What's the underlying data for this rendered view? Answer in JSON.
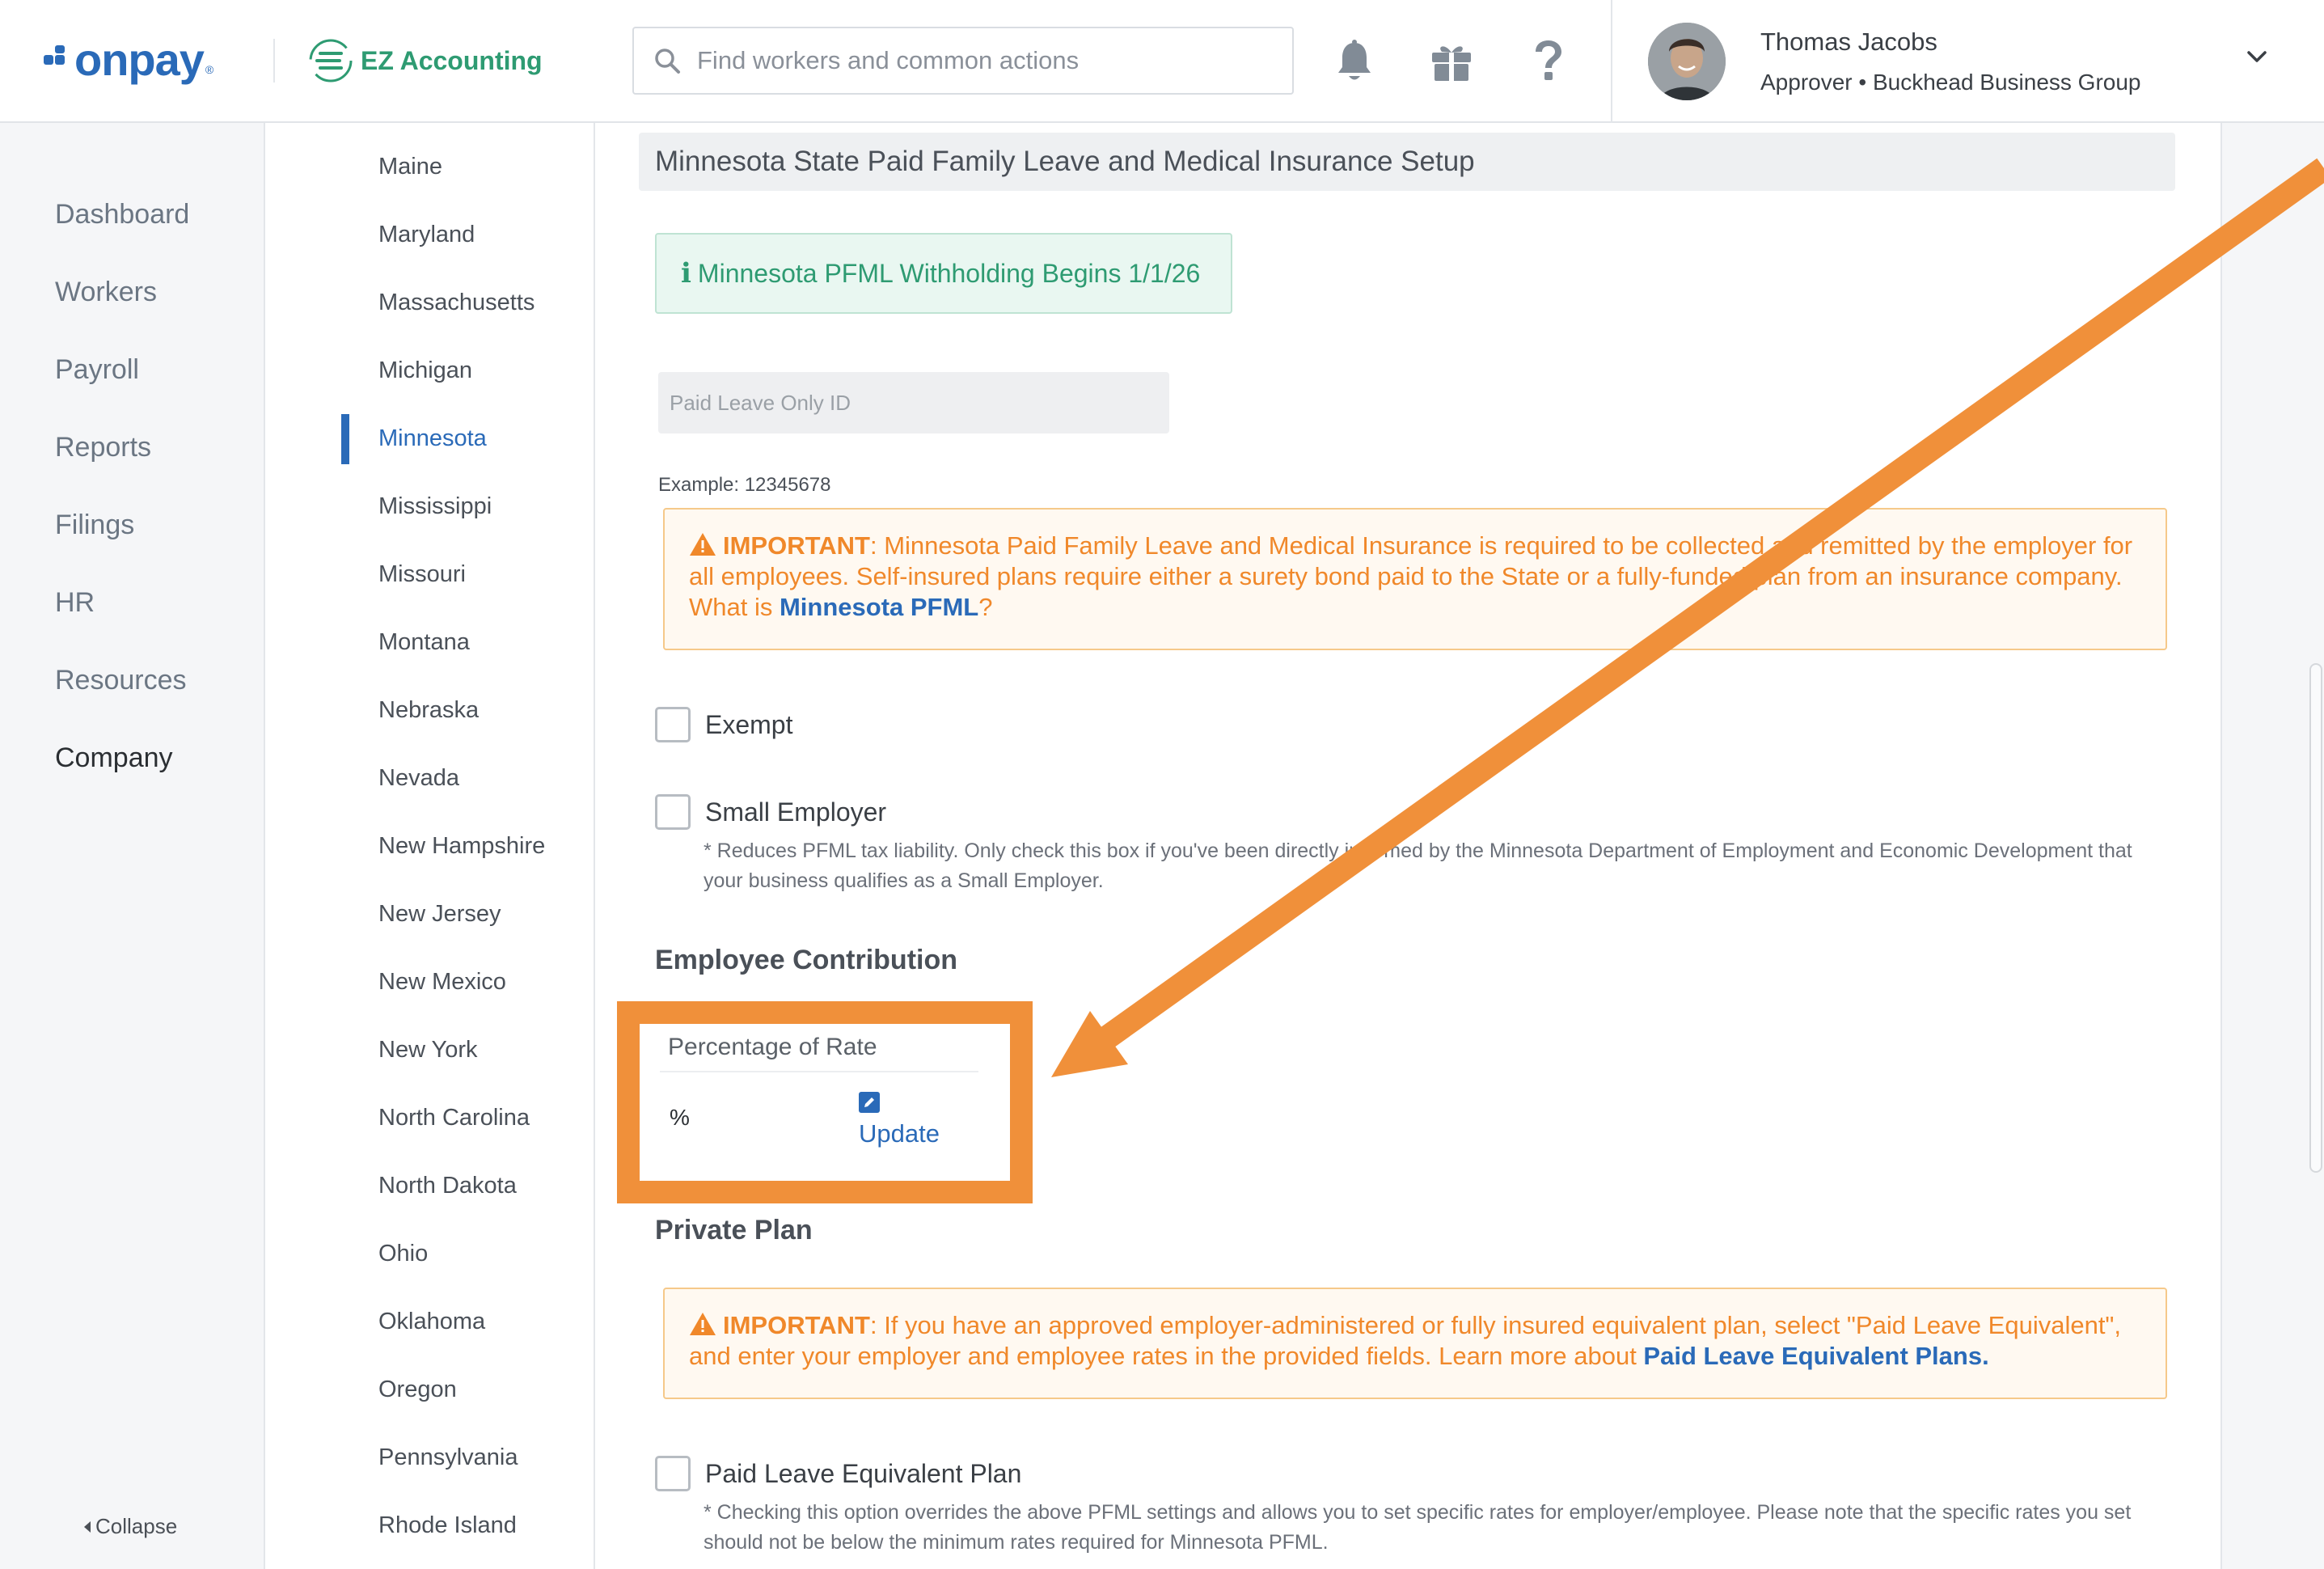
{
  "brand": {
    "onpay": "onpay",
    "partner": "EZ Accounting"
  },
  "search": {
    "placeholder": "Find workers and common actions"
  },
  "user": {
    "name": "Thomas Jacobs",
    "role": "Approver • Buckhead Business Group"
  },
  "nav": {
    "items": [
      {
        "label": "Dashboard",
        "active": false
      },
      {
        "label": "Workers",
        "active": false
      },
      {
        "label": "Payroll",
        "active": false
      },
      {
        "label": "Reports",
        "active": false
      },
      {
        "label": "Filings",
        "active": false
      },
      {
        "label": "HR",
        "active": false
      },
      {
        "label": "Resources",
        "active": false
      },
      {
        "label": "Company",
        "active": true
      }
    ],
    "collapse": "Collapse"
  },
  "states": {
    "items": [
      "Maine",
      "Maryland",
      "Massachusetts",
      "Michigan",
      "Minnesota",
      "Mississippi",
      "Missouri",
      "Montana",
      "Nebraska",
      "Nevada",
      "New Hampshire",
      "New Jersey",
      "New Mexico",
      "New York",
      "North Carolina",
      "North Dakota",
      "Ohio",
      "Oklahoma",
      "Oregon",
      "Pennsylvania",
      "Rhode Island"
    ],
    "selected": "Minnesota"
  },
  "main": {
    "section_title": "Minnesota State Paid Family Leave and Medical Insurance Setup",
    "info_banner": "Minnesota PFML Withholding Begins 1/1/26",
    "id_field": {
      "placeholder": "Paid Leave Only ID",
      "value": ""
    },
    "example": "Example: 12345678",
    "important_label": "IMPORTANT",
    "warning1": {
      "text": ": Minnesota Paid Family Leave and Medical Insurance is required to be collected and remitted by the employer for all employees. Self-insured plans require either a surety bond paid to the State or a fully-funded plan from an insurance company. What is ",
      "link": "Minnesota PFML",
      "suffix": "?"
    },
    "exempt": {
      "label": "Exempt",
      "checked": false
    },
    "small_employer": {
      "label": "Small Employer",
      "checked": false,
      "note": "* Reduces PFML tax liability. Only check this box if you've been directly informed by the Minnesota Department of Employment and Economic Development that your business qualifies as a Small Employer."
    },
    "employee_contribution": {
      "heading": "Employee Contribution",
      "column": "Percentage of Rate",
      "value": "%",
      "update": "Update"
    },
    "private_plan": {
      "heading": "Private Plan",
      "warning": {
        "text": ": If you have an approved employer-administered or fully insured equivalent plan, select \"Paid Leave Equivalent\", and enter your employer and employee rates in the provided fields. Learn more about ",
        "link": "Paid Leave Equivalent Plans."
      },
      "equivalent": {
        "label": "Paid Leave Equivalent Plan",
        "checked": false,
        "note": "* Checking this option overrides the above PFML settings and allows you to set specific rates for employer/employee. Please note that the specific rates you set should not be below the minimum rates required for Minnesota PFML."
      }
    }
  },
  "colors": {
    "accent": "#2a6ab8",
    "success": "#2e9b72",
    "warning": "#f0882a",
    "annotation": "#f0903a"
  },
  "icons": [
    "search-icon",
    "bell-icon",
    "gift-icon",
    "help-icon",
    "chevron-down-icon",
    "info-icon",
    "warning-icon",
    "edit-icon",
    "caret-left-icon"
  ]
}
